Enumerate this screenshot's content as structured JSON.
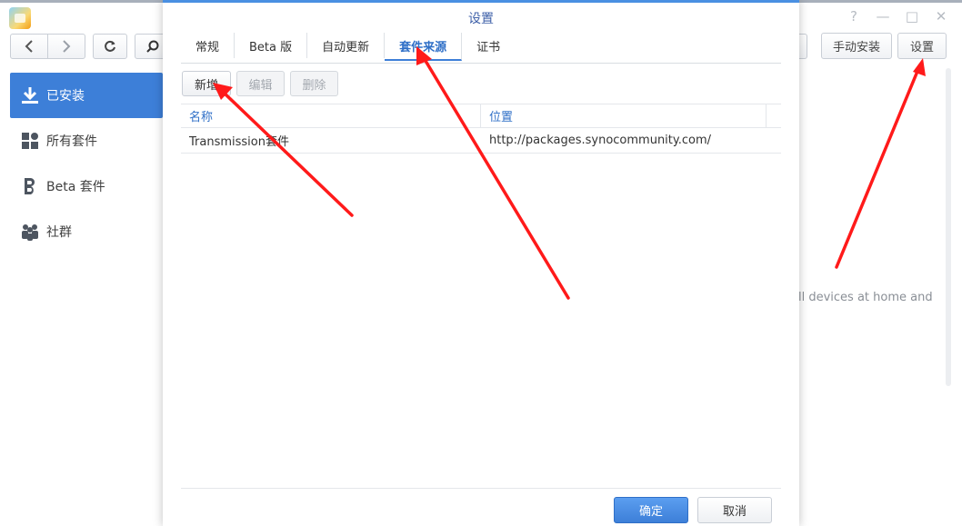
{
  "window": {
    "controls": [
      "?",
      "—",
      "□",
      "✕"
    ]
  },
  "toolbar": {
    "manual_install": "手动安装",
    "settings": "设置"
  },
  "sidebar": {
    "items": [
      {
        "label": "已安装",
        "icon": "download-icon",
        "active": true
      },
      {
        "label": "所有套件",
        "icon": "grid-icon",
        "active": false
      },
      {
        "label": "Beta 套件",
        "icon": "beta-icon",
        "active": false
      },
      {
        "label": "社群",
        "icon": "community-icon",
        "active": false
      }
    ]
  },
  "background": {
    "partial_text": "ll devices at home and"
  },
  "dialog": {
    "title": "设置",
    "tabs": [
      {
        "label": "常规"
      },
      {
        "label": "Beta 版"
      },
      {
        "label": "自动更新"
      },
      {
        "label": "套件来源",
        "active": true
      },
      {
        "label": "证书"
      }
    ],
    "buttons": {
      "add": "新增",
      "edit": "编辑",
      "delete": "删除"
    },
    "table": {
      "headers": [
        "名称",
        "位置"
      ],
      "rows": [
        [
          "Transmission套件",
          "http://packages.synocommunity.com/"
        ]
      ]
    },
    "footer": {
      "ok": "确定",
      "cancel": "取消"
    }
  },
  "annotation_color": "#ff1a1a",
  "accent_color": "#3d7fd8"
}
